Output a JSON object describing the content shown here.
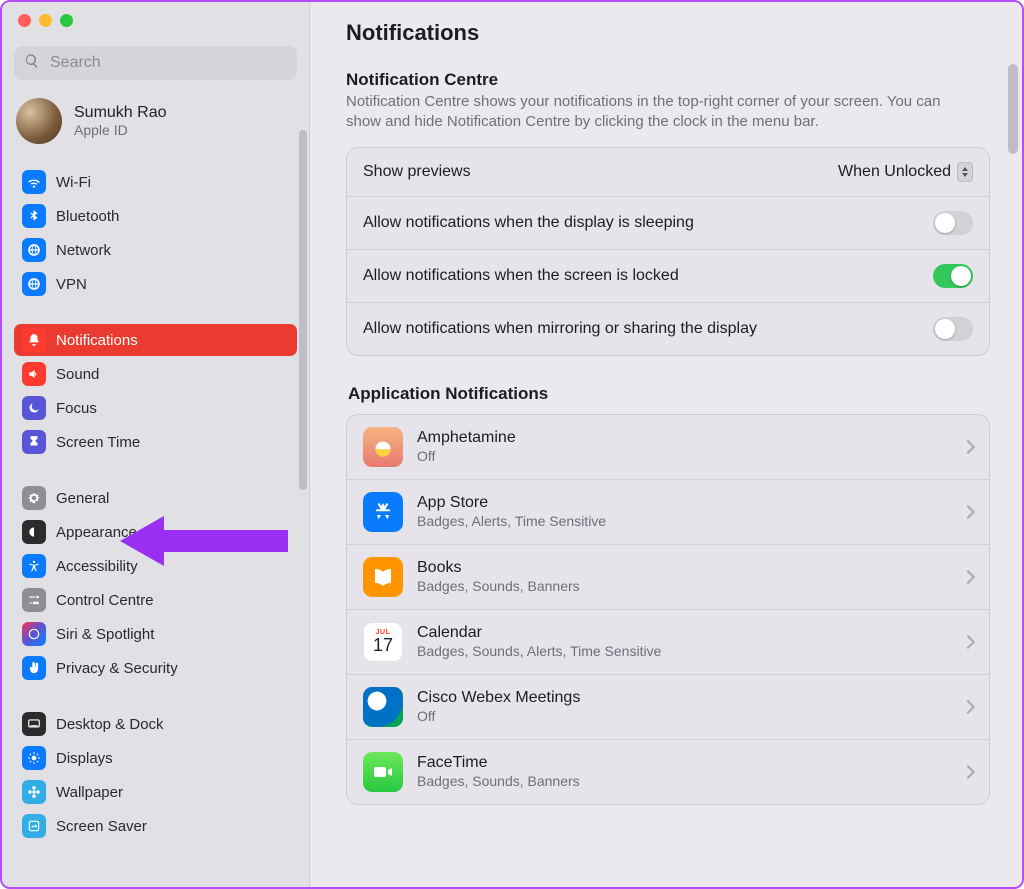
{
  "search": {
    "placeholder": "Search"
  },
  "profile": {
    "name": "Sumukh Rao",
    "sub": "Apple ID"
  },
  "sidebar": {
    "groups": [
      {
        "items": [
          {
            "id": "wifi",
            "label": "Wi-Fi",
            "color": "ic-blue",
            "icon": "wifi"
          },
          {
            "id": "bluetooth",
            "label": "Bluetooth",
            "color": "ic-blue",
            "icon": "bluetooth"
          },
          {
            "id": "network",
            "label": "Network",
            "color": "ic-blue",
            "icon": "globe"
          },
          {
            "id": "vpn",
            "label": "VPN",
            "color": "ic-blue",
            "icon": "globe"
          }
        ]
      },
      {
        "items": [
          {
            "id": "notifications",
            "label": "Notifications",
            "color": "ic-red",
            "icon": "bell",
            "active": true
          },
          {
            "id": "sound",
            "label": "Sound",
            "color": "ic-red",
            "icon": "speaker"
          },
          {
            "id": "focus",
            "label": "Focus",
            "color": "ic-indigo",
            "icon": "moon"
          },
          {
            "id": "screentime",
            "label": "Screen Time",
            "color": "ic-indigo",
            "icon": "hourglass"
          }
        ]
      },
      {
        "items": [
          {
            "id": "general",
            "label": "General",
            "color": "ic-gray",
            "icon": "gear"
          },
          {
            "id": "appearance",
            "label": "Appearance",
            "color": "ic-black",
            "icon": "appearance"
          },
          {
            "id": "accessibility",
            "label": "Accessibility",
            "color": "ic-blue",
            "icon": "accessibility"
          },
          {
            "id": "controlcentre",
            "label": "Control Centre",
            "color": "ic-gray",
            "icon": "sliders"
          },
          {
            "id": "siri",
            "label": "Siri & Spotlight",
            "color": "ic-grad",
            "icon": "siri"
          },
          {
            "id": "privacy",
            "label": "Privacy & Security",
            "color": "ic-blue",
            "icon": "hand"
          }
        ]
      },
      {
        "items": [
          {
            "id": "desktop",
            "label": "Desktop & Dock",
            "color": "ic-black",
            "icon": "dock"
          },
          {
            "id": "displays",
            "label": "Displays",
            "color": "ic-blue",
            "icon": "sun"
          },
          {
            "id": "wallpaper",
            "label": "Wallpaper",
            "color": "ic-teal",
            "icon": "flower"
          },
          {
            "id": "screensaver",
            "label": "Screen Saver",
            "color": "ic-teal",
            "icon": "screensaver"
          }
        ]
      }
    ]
  },
  "page": {
    "title": "Notifications",
    "centre_title": "Notification Centre",
    "centre_desc": "Notification Centre shows your notifications in the top-right corner of your screen. You can show and hide Notification Centre by clicking the clock in the menu bar.",
    "rows": {
      "previews_label": "Show previews",
      "previews_value": "When Unlocked",
      "sleep_label": "Allow notifications when the display is sleeping",
      "sleep_on": false,
      "locked_label": "Allow notifications when the screen is locked",
      "locked_on": true,
      "mirror_label": "Allow notifications when mirroring or sharing the display",
      "mirror_on": false
    },
    "apps_title": "Application Notifications",
    "apps": [
      {
        "id": "amphetamine",
        "name": "Amphetamine",
        "sub": "Off",
        "icon": "ai-amph"
      },
      {
        "id": "appstore",
        "name": "App Store",
        "sub": "Badges, Alerts, Time Sensitive",
        "icon": "ai-appstore"
      },
      {
        "id": "books",
        "name": "Books",
        "sub": "Badges, Sounds, Banners",
        "icon": "ai-books"
      },
      {
        "id": "calendar",
        "name": "Calendar",
        "sub": "Badges, Sounds, Alerts, Time Sensitive",
        "icon": "ai-cal"
      },
      {
        "id": "webex",
        "name": "Cisco Webex Meetings",
        "sub": "Off",
        "icon": "ai-webex"
      },
      {
        "id": "facetime",
        "name": "FaceTime",
        "sub": "Badges, Sounds, Banners",
        "icon": "ai-ft"
      }
    ],
    "calendar_month": "JUL",
    "calendar_day": "17"
  }
}
